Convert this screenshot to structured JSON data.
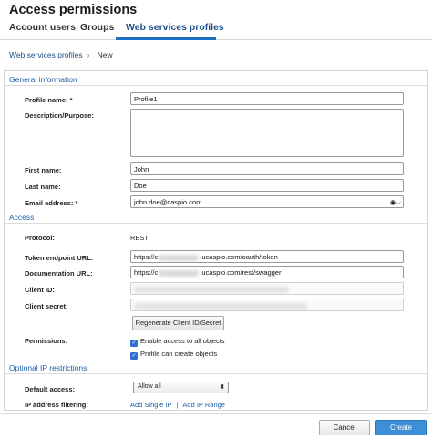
{
  "page": {
    "title": "Access permissions"
  },
  "tabs": [
    {
      "label": "Account users"
    },
    {
      "label": "Groups"
    },
    {
      "label": "Web services profiles",
      "active": true
    }
  ],
  "breadcrumb": {
    "parent": "Web services profiles",
    "current": "New"
  },
  "general": {
    "heading": "General information",
    "profile_name_label": "Profile name: *",
    "profile_name_value": "Profile1",
    "description_label": "Description/Purpose:",
    "description_value": "",
    "first_name_label": "First name:",
    "first_name_value": "John",
    "last_name_label": "Last name:",
    "last_name_value": "Doe",
    "email_label": "Email address: *",
    "email_value": "john.doe@caspio.com",
    "email_icon": "contact-card-icon"
  },
  "access": {
    "heading": "Access",
    "protocol_label": "Protocol:",
    "protocol_value": "REST",
    "token_label": "Token endpoint URL:",
    "token_prefix": "https://c",
    "token_suffix": ".ucaspio.com/oauth/token",
    "docs_label": "Documentation URL:",
    "docs_prefix": "https://c",
    "docs_suffix": ".ucaspio.com/rest/swagger",
    "client_id_label": "Client ID:",
    "client_secret_label": "Client secret:",
    "regenerate_label": "Regenerate Client ID/Secret",
    "permissions_label": "Permissions:",
    "perm_all_objects": "Enable access to all objects",
    "perm_create_objects": "Profile can create objects"
  },
  "ip": {
    "heading": "Optional IP restrictions",
    "default_access_label": "Default access:",
    "default_access_value": "Allow all",
    "filtering_label": "IP address filtering:",
    "add_single_ip": "Add Single IP",
    "separator": "|",
    "add_ip_range": "Add IP Range"
  },
  "footer": {
    "cancel_label": "Cancel",
    "create_label": "Create"
  },
  "colors": {
    "accent": "#1d5fa8",
    "primary_button": "#3d8fd8",
    "checkbox": "#2e6fd1"
  }
}
